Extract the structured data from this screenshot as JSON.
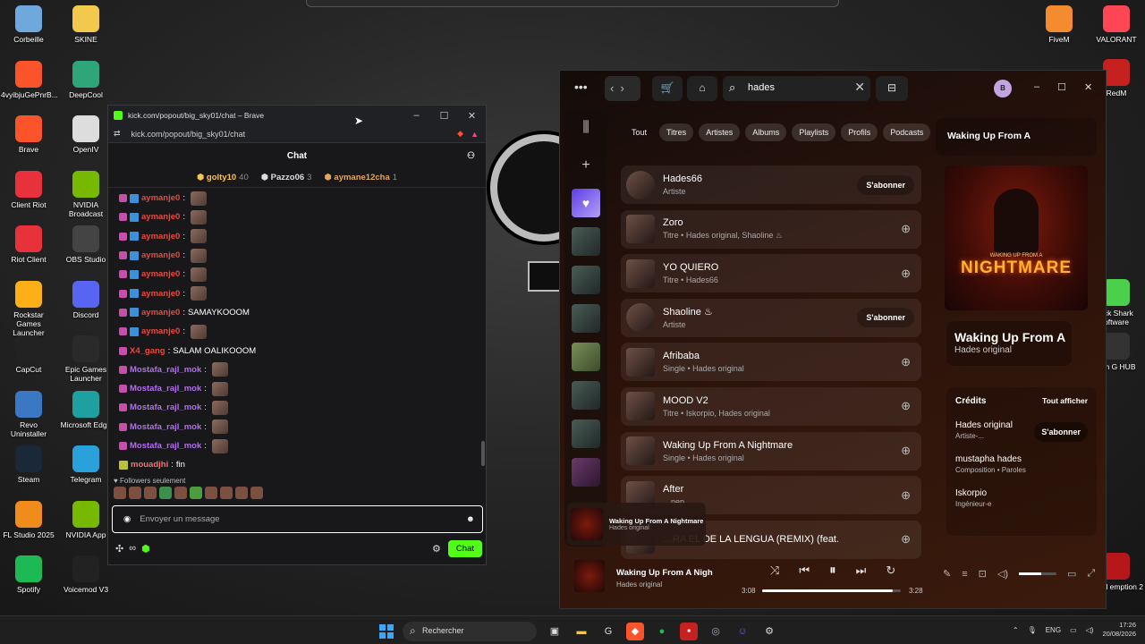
{
  "desktop": {
    "left_icons": [
      {
        "label": "Corbeille",
        "icon": "trash-icon",
        "color": "#6fa8dc"
      },
      {
        "label": "SKINE",
        "icon": "folder-icon",
        "color": "#f2c94c"
      },
      {
        "label": "4vyibjuGePnrB...",
        "icon": "brave-icon",
        "color": "#fb542b"
      },
      {
        "label": "DeepCool",
        "icon": "deepcool-icon",
        "color": "#2fa57a"
      },
      {
        "label": "Brave",
        "icon": "brave-icon",
        "color": "#fb542b"
      },
      {
        "label": "OpenIV",
        "icon": "openiv-icon",
        "color": "#ddd"
      },
      {
        "label": "Client Riot",
        "icon": "riot-icon",
        "color": "#e8323b"
      },
      {
        "label": "NVIDIA Broadcast",
        "icon": "nvidia-icon",
        "color": "#76b900"
      },
      {
        "label": "Riot Client",
        "icon": "riot-icon",
        "color": "#e8323b"
      },
      {
        "label": "OBS Studio",
        "icon": "obs-icon",
        "color": "#444"
      },
      {
        "label": "Rockstar Games Launcher",
        "icon": "rockstar-icon",
        "color": "#fcaf17"
      },
      {
        "label": "Discord",
        "icon": "discord-icon",
        "color": "#5865f2"
      },
      {
        "label": "CapCut",
        "icon": "capcut-icon",
        "color": "#222"
      },
      {
        "label": "Epic Games Launcher",
        "icon": "epic-icon",
        "color": "#2a2a2a"
      },
      {
        "label": "Revo Uninstaller",
        "icon": "revo-icon",
        "color": "#3b78c4"
      },
      {
        "label": "Microsoft Edge",
        "icon": "edge-icon",
        "color": "#1fa0a0"
      },
      {
        "label": "Steam",
        "icon": "steam-icon",
        "color": "#1b2838"
      },
      {
        "label": "Telegram",
        "icon": "telegram-icon",
        "color": "#2aa1da"
      },
      {
        "label": "FL Studio 2025",
        "icon": "flstudio-icon",
        "color": "#f08c1c"
      },
      {
        "label": "NVIDIA App",
        "icon": "nvidia-icon",
        "color": "#76b900"
      },
      {
        "label": "Spotify",
        "icon": "spotify-icon",
        "color": "#1db954"
      },
      {
        "label": "Voicemod V3",
        "icon": "voicemod-icon",
        "color": "#222"
      }
    ],
    "right_icons": [
      {
        "label": "FiveM",
        "icon": "fivem-icon",
        "color": "#f48b2f"
      },
      {
        "label": "VALORANT",
        "icon": "valorant-icon",
        "color": "#ff4655"
      },
      {
        "label": "RedM",
        "icon": "redm-icon",
        "color": "#c4211f"
      },
      {
        "label": "ack Shark oftware",
        "icon": "shark-icon",
        "color": "#4ad04a"
      },
      {
        "label": "ech G HUB",
        "icon": "ghub-icon",
        "color": "#333"
      },
      {
        "label": "Dead emption 2",
        "icon": "rdr2-icon",
        "color": "#b5171b"
      }
    ]
  },
  "chat_window": {
    "title": "kick.com/popout/big_sky01/chat – Brave",
    "url": "kick.com/popout/big_sky01/chat",
    "header": "Chat",
    "leaderboard": [
      {
        "name": "golty10",
        "count": "40"
      },
      {
        "name": "Pazzo06",
        "count": "3"
      },
      {
        "name": "aymane12cha",
        "count": "1"
      }
    ],
    "messages": [
      {
        "user": "aymanje0",
        "text": "",
        "emote": true,
        "badge": "sub"
      },
      {
        "user": "aymanje0",
        "text": "",
        "emote": true,
        "badge": "sub"
      },
      {
        "user": "aymanje0",
        "text": "",
        "emote": true,
        "badge": "sub"
      },
      {
        "user": "aymanje0",
        "text": "",
        "emote": true,
        "badge": "sub"
      },
      {
        "user": "aymanje0",
        "text": "",
        "emote": true,
        "badge": "sub"
      },
      {
        "user": "aymanje0",
        "text": "",
        "emote": true,
        "badge": "sub"
      },
      {
        "user": "aymanje0",
        "text": "SAMAYKOOOM",
        "emote": false,
        "badge": "sub"
      },
      {
        "user": "aymanje0",
        "text": "",
        "emote": true,
        "badge": "sub"
      },
      {
        "user": "X4_gang",
        "text": "SALAM OALIKOOOM",
        "emote": false,
        "badge": "none"
      },
      {
        "user": "Mostafa_rajl_mok",
        "text": "",
        "emote": true,
        "badge": "none"
      },
      {
        "user": "Mostafa_rajl_mok",
        "text": "",
        "emote": true,
        "badge": "none"
      },
      {
        "user": "Mostafa_rajl_mok",
        "text": "",
        "emote": true,
        "badge": "none"
      },
      {
        "user": "Mostafa_rajl_mok",
        "text": "",
        "emote": true,
        "badge": "none"
      },
      {
        "user": "Mostafa_rajl_mok",
        "text": "",
        "emote": true,
        "badge": "none"
      },
      {
        "user": "mouadjhi",
        "text": "fin",
        "emote": false,
        "badge": "gift"
      }
    ],
    "followers_only": "Followers seulement",
    "input_placeholder": "Envoyer un message",
    "send_label": "Chat"
  },
  "spotify": {
    "search_query": "hades",
    "avatar_letter": "B",
    "filters": [
      "Tout",
      "Titres",
      "Artistes",
      "Albums",
      "Playlists",
      "Profils",
      "Podcasts"
    ],
    "results": [
      {
        "title": "Hades66",
        "sub": "Artiste",
        "action": "S'abonner"
      },
      {
        "title": "Zoro",
        "sub": "Titre • Hades original, Shaoline ♨",
        "action": "add"
      },
      {
        "title": "YO QUIERO",
        "sub": "Titre • Hades66",
        "action": "add"
      },
      {
        "title": "Shaoline ♨",
        "sub": "Artiste",
        "action": "S'abonner"
      },
      {
        "title": "Afribaba",
        "sub": "Single • Hades original",
        "action": "add"
      },
      {
        "title": "MOOD V2",
        "sub": "Titre • Iskorpio, Hades original",
        "action": "add"
      },
      {
        "title": "Waking Up From A Nightmare",
        "sub": "Single • Hades original",
        "action": "add"
      },
      {
        "title": "After",
        "sub": "…nep",
        "action": "add"
      },
      {
        "title": "…RA EL DE LA LENGUA (REMIX) (feat.",
        "sub": "",
        "action": "add"
      }
    ],
    "panel_title": "Waking Up From A",
    "cover_small": "WAKING UP FROM A",
    "cover_big": "NIGHTMARE",
    "now_playing_title": "Waking Up From A",
    "now_playing_artist": "Hades original",
    "credits_title": "Crédits",
    "credits_all": "Tout afficher",
    "credits": [
      {
        "name": "Hades original",
        "role": "Artiste-...",
        "action": "S'abonner"
      },
      {
        "name": "mustapha hades",
        "role": "Composition • Paroles"
      },
      {
        "name": "Iskorpio",
        "role": "Ingénieur-e"
      }
    ],
    "mini_title": "Waking Up From A Nightmare",
    "mini_artist": "Hades original",
    "player_title": "Waking Up From A Nigh",
    "player_artist": "Hades original",
    "elapsed": "3:08",
    "duration": "3:28",
    "progress": 0.94,
    "volume": 0.6
  },
  "taskbar": {
    "search": "Rechercher",
    "lang": "ENG",
    "time": "17:26",
    "date": "20/08/2026"
  }
}
